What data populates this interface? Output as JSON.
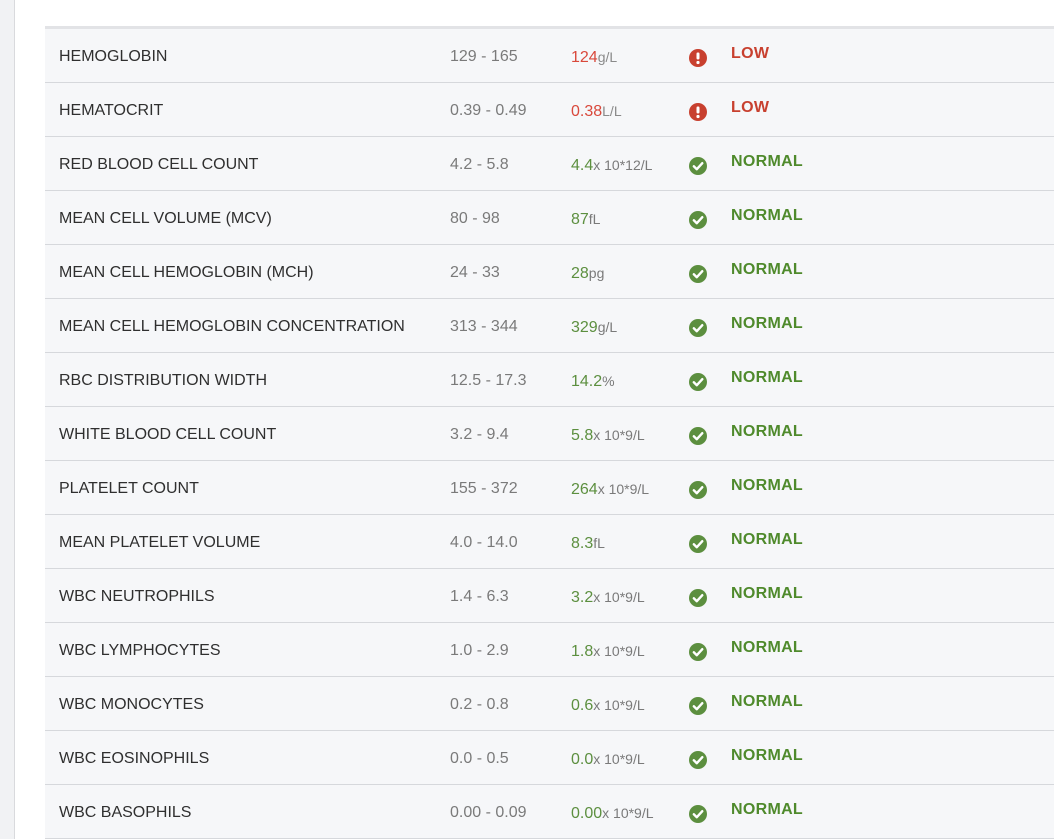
{
  "colors": {
    "low": "#d9483b",
    "normal": "#5c8f3f",
    "row_bg": "#f6f7f9"
  },
  "rows": [
    {
      "name": "HEMOGLOBIN",
      "range": "129 - 165",
      "value": "124",
      "unit": "g/L",
      "status": "LOW",
      "icon": "alert-icon"
    },
    {
      "name": "HEMATOCRIT",
      "range": "0.39 - 0.49",
      "value": "0.38",
      "unit": "L/L",
      "status": "LOW",
      "icon": "alert-icon"
    },
    {
      "name": "RED BLOOD CELL COUNT",
      "range": "4.2 - 5.8",
      "value": "4.4",
      "unit": "x 10*12/L",
      "status": "NORMAL",
      "icon": "check-icon"
    },
    {
      "name": "MEAN CELL VOLUME (MCV)",
      "range": "80 - 98",
      "value": "87",
      "unit": "fL",
      "status": "NORMAL",
      "icon": "check-icon"
    },
    {
      "name": "MEAN CELL HEMOGLOBIN (MCH)",
      "range": "24 - 33",
      "value": "28",
      "unit": "pg",
      "status": "NORMAL",
      "icon": "check-icon"
    },
    {
      "name": "MEAN CELL HEMOGLOBIN CONCENTRATION",
      "range": "313 - 344",
      "value": "329",
      "unit": "g/L",
      "status": "NORMAL",
      "icon": "check-icon"
    },
    {
      "name": "RBC DISTRIBUTION WIDTH",
      "range": "12.5 - 17.3",
      "value": "14.2",
      "unit": "%",
      "status": "NORMAL",
      "icon": "check-icon"
    },
    {
      "name": "WHITE BLOOD CELL COUNT",
      "range": "3.2 - 9.4",
      "value": "5.8",
      "unit": "x 10*9/L",
      "status": "NORMAL",
      "icon": "check-icon"
    },
    {
      "name": "PLATELET COUNT",
      "range": "155 - 372",
      "value": "264",
      "unit": "x 10*9/L",
      "status": "NORMAL",
      "icon": "check-icon"
    },
    {
      "name": "MEAN PLATELET VOLUME",
      "range": "4.0 - 14.0",
      "value": "8.3",
      "unit": "fL",
      "status": "NORMAL",
      "icon": "check-icon"
    },
    {
      "name": "WBC NEUTROPHILS",
      "range": "1.4 - 6.3",
      "value": "3.2",
      "unit": "x 10*9/L",
      "status": "NORMAL",
      "icon": "check-icon"
    },
    {
      "name": "WBC LYMPHOCYTES",
      "range": "1.0 - 2.9",
      "value": "1.8",
      "unit": "x 10*9/L",
      "status": "NORMAL",
      "icon": "check-icon"
    },
    {
      "name": "WBC MONOCYTES",
      "range": "0.2 - 0.8",
      "value": "0.6",
      "unit": "x 10*9/L",
      "status": "NORMAL",
      "icon": "check-icon"
    },
    {
      "name": "WBC EOSINOPHILS",
      "range": "0.0 - 0.5",
      "value": "0.0",
      "unit": "x 10*9/L",
      "status": "NORMAL",
      "icon": "check-icon"
    },
    {
      "name": "WBC BASOPHILS",
      "range": "0.00 - 0.09",
      "value": "0.00",
      "unit": "x 10*9/L",
      "status": "NORMAL",
      "icon": "check-icon"
    }
  ]
}
